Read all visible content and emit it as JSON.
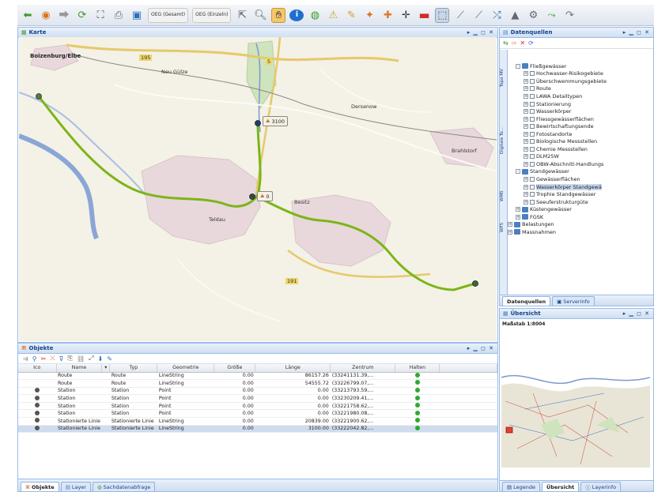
{
  "toolbar": {
    "btn_overall": "OEG (Gesamt)",
    "btn_single": "OEG (Einzeln)"
  },
  "map_panel": {
    "title": "Karte",
    "tools": "▸ ▁ ◻ ✕",
    "city_label": "Boizenburg/Elbe",
    "places": [
      "Neu Gülze",
      "Dersenow",
      "Brahlstorf",
      "Teldau",
      "Besitz"
    ],
    "roads": [
      "195",
      "5",
      "191"
    ],
    "marker_a": "3100",
    "marker_b": "0"
  },
  "data_sources_panel": {
    "title": "Datenquellen",
    "tools": "▸ ▁ ◻ ✕",
    "side_tabs": [
      "Topo MV",
      "Digitale To...",
      "WMS",
      "WFS"
    ],
    "tree": [
      {
        "level": 1,
        "pm": "-",
        "type": "folder",
        "label": "Fließgewässer"
      },
      {
        "level": 2,
        "pm": "+",
        "type": "check",
        "label": "Hochwasser-Risikogebiete"
      },
      {
        "level": 2,
        "pm": "+",
        "type": "check",
        "label": "Überschwemmungsgebiete"
      },
      {
        "level": 2,
        "pm": "+",
        "type": "check",
        "label": "Route"
      },
      {
        "level": 2,
        "pm": "+",
        "type": "check",
        "label": "LAWA Detailtypen"
      },
      {
        "level": 2,
        "pm": "+",
        "type": "check",
        "label": "Stationierung"
      },
      {
        "level": 2,
        "pm": "+",
        "type": "check",
        "label": "Wasserkörper"
      },
      {
        "level": 2,
        "pm": "+",
        "type": "check",
        "label": "Fliessgewässerflächen"
      },
      {
        "level": 2,
        "pm": "+",
        "type": "check",
        "label": "Bewirtschaftungsende"
      },
      {
        "level": 2,
        "pm": "+",
        "type": "check",
        "label": "Fotostandorte"
      },
      {
        "level": 2,
        "pm": "+",
        "type": "check",
        "label": "Biologische Messstellen"
      },
      {
        "level": 2,
        "pm": "+",
        "type": "check",
        "label": "Chemie Messstellen"
      },
      {
        "level": 2,
        "pm": "+",
        "type": "check",
        "label": "DLM25W"
      },
      {
        "level": 2,
        "pm": "+",
        "type": "check",
        "label": "OBW-Abschnitt-Handlungs"
      },
      {
        "level": 1,
        "pm": "-",
        "type": "folder",
        "label": "Standgewässer"
      },
      {
        "level": 2,
        "pm": "+",
        "type": "check",
        "label": "Gewässerflächen"
      },
      {
        "level": 2,
        "pm": "+",
        "type": "check",
        "label": "Wasserkörper Standgewä",
        "selected": true
      },
      {
        "level": 2,
        "pm": "+",
        "type": "check",
        "label": "Trophie Standgewässer"
      },
      {
        "level": 2,
        "pm": "+",
        "type": "check",
        "label": "Seeuferstrukturgüte"
      },
      {
        "level": 1,
        "pm": "+",
        "type": "folder",
        "label": "Küstengewässer"
      },
      {
        "level": 1,
        "pm": "+",
        "type": "folder",
        "label": "FGSK"
      },
      {
        "level": 0,
        "pm": "+",
        "type": "folder",
        "label": "Belastungen"
      },
      {
        "level": 0,
        "pm": "+",
        "type": "folder",
        "label": "Massnahmen"
      }
    ],
    "bottom_tabs": [
      "Datenquellen",
      "Serverinfo"
    ]
  },
  "overview_panel": {
    "title": "Übersicht",
    "tools": "▸ ▁ ◻ ✕",
    "caption": "Maßstab 1:8004",
    "bottom_tabs": [
      "Legende",
      "Übersicht",
      "Layerinfo"
    ]
  },
  "objects_panel": {
    "title": "Objekte",
    "tools": "▸ ▁ ◻ ✕",
    "columns": [
      "Ico",
      "Name",
      "▾",
      "Typ",
      "Geometrie",
      "Größe",
      "Länge",
      "Zentrum",
      "Halten"
    ],
    "rows": [
      {
        "icon": "",
        "name": "Route",
        "type": "Route",
        "geometry": "LineString",
        "size": "0.00",
        "length": "86157.26",
        "center": "(33241131.39,...",
        "selected": false
      },
      {
        "icon": "",
        "name": "Route",
        "type": "Route",
        "geometry": "LineString",
        "size": "0.00",
        "length": "54555.72",
        "center": "(33226799.07,...",
        "selected": false
      },
      {
        "icon": "station",
        "name": "Station",
        "type": "Station",
        "geometry": "Point",
        "size": "0.00",
        "length": "0.00",
        "center": "(33213793.59,...",
        "selected": false
      },
      {
        "icon": "station",
        "name": "Station",
        "type": "Station",
        "geometry": "Point",
        "size": "0.00",
        "length": "0.00",
        "center": "(33230209.41,...",
        "selected": false
      },
      {
        "icon": "station",
        "name": "Station",
        "type": "Station",
        "geometry": "Point",
        "size": "0.00",
        "length": "0.00",
        "center": "(33221758.62,...",
        "selected": false
      },
      {
        "icon": "station",
        "name": "Station",
        "type": "Station",
        "geometry": "Point",
        "size": "0.00",
        "length": "0.00",
        "center": "(33221980.08,...",
        "selected": false
      },
      {
        "icon": "station",
        "name": "Stationierte Linie",
        "type": "Stationierte Linie",
        "geometry": "LineString",
        "size": "0.00",
        "length": "20839.00",
        "center": "(33221900.62,...",
        "selected": false
      },
      {
        "icon": "station",
        "name": "Stationierte Linie",
        "type": "Stationierte Linie",
        "geometry": "LineString",
        "size": "0.00",
        "length": "3100.00",
        "center": "(33222042.82,...",
        "selected": true
      }
    ],
    "bottom_tabs": [
      "Objekte",
      "Layer",
      "Sachdatenabfrage"
    ]
  },
  "colors": {
    "accent": "#15428b",
    "route": "#7cb518",
    "river": "#8aa6d6",
    "status_ok": "#2fa92f"
  }
}
